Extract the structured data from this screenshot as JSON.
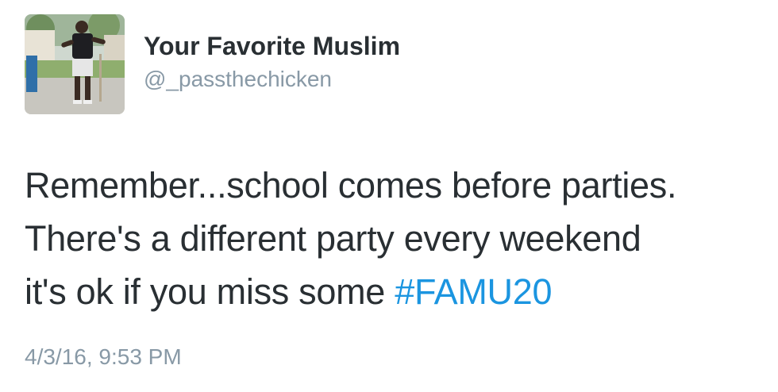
{
  "user": {
    "display_name": "Your Favorite Muslim",
    "handle": "@_passthechicken"
  },
  "tweet": {
    "line1": "Remember...school comes before parties.",
    "line2": "There's a different party every weekend",
    "line3_text": "it's ok if you miss some ",
    "hashtag": "#FAMU20",
    "timestamp": "4/3/16, 9:53 PM"
  },
  "colors": {
    "text": "#292f33",
    "secondary": "#8899a6",
    "link": "#1b95e0",
    "background": "#ffffff"
  },
  "icons": {
    "avatar": "profile-photo"
  }
}
